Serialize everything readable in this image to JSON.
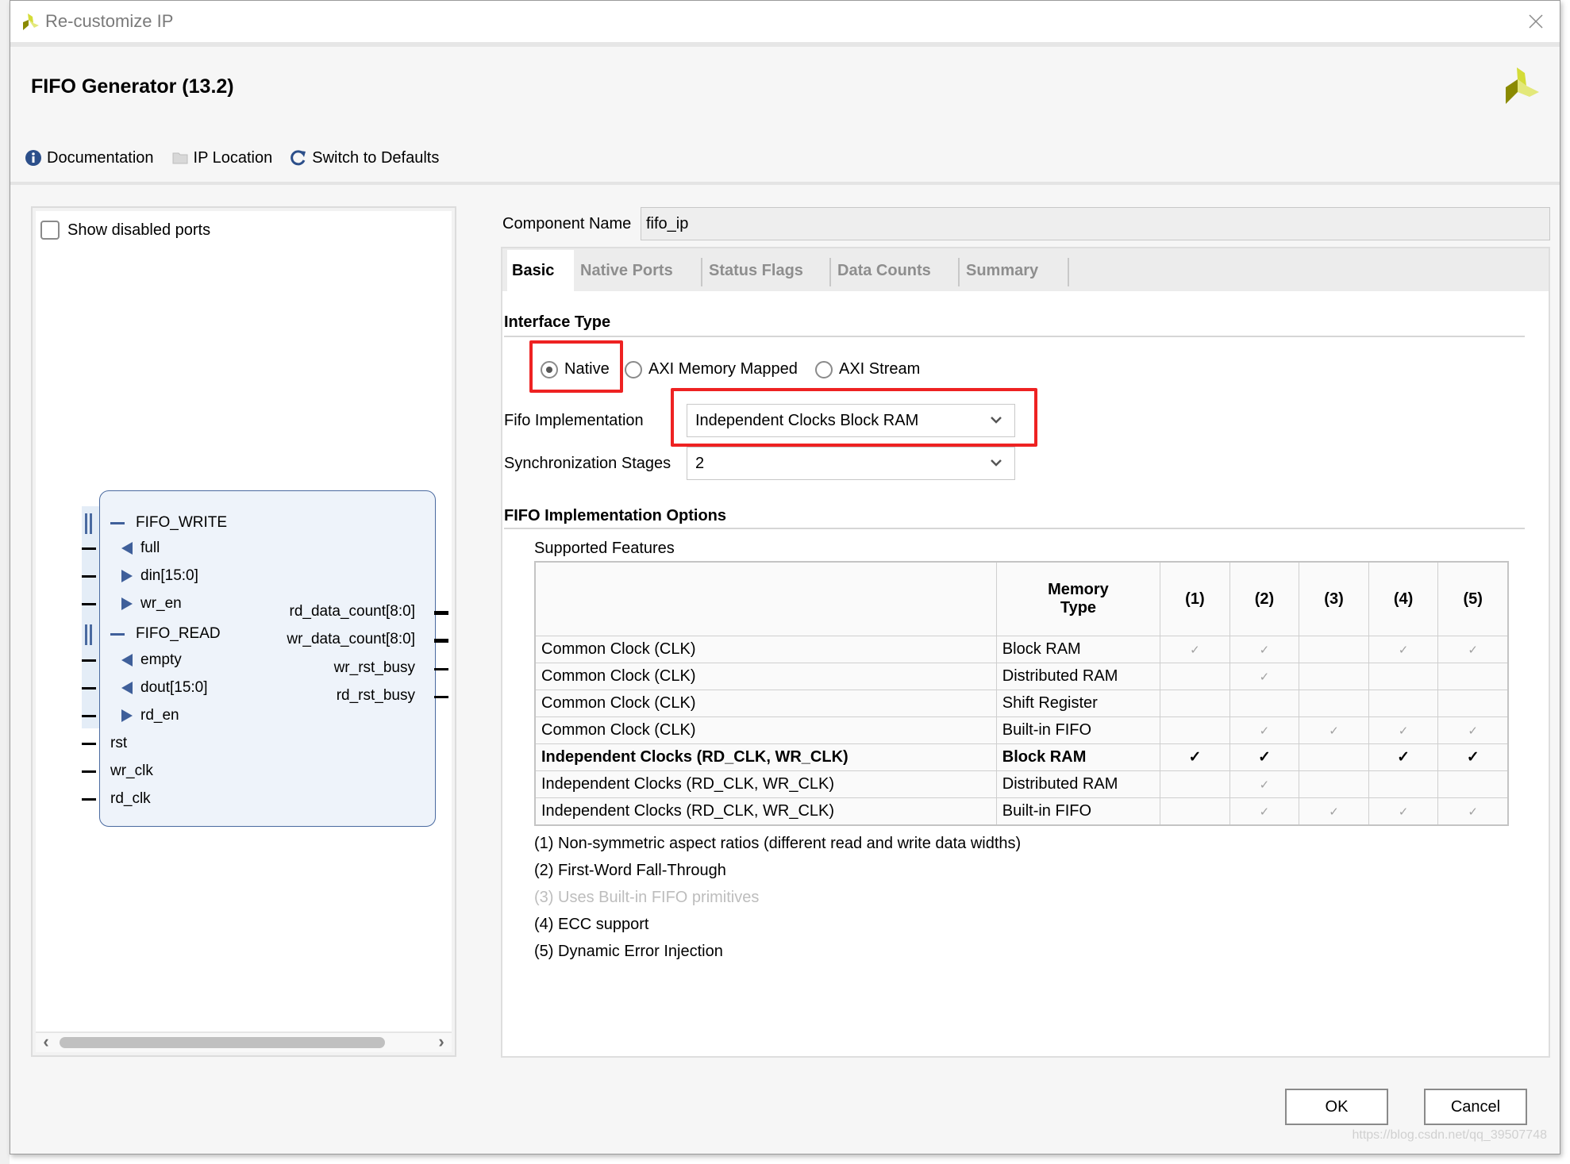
{
  "window": {
    "title": "Re-customize IP",
    "close_icon": "close-icon"
  },
  "header": {
    "title": "FIFO Generator (13.2)",
    "brand_icon": "xilinx-logo-icon"
  },
  "toolbar": {
    "documentation": "Documentation",
    "ip_location": "IP Location",
    "switch_defaults": "Switch to Defaults"
  },
  "left_panel": {
    "show_disabled_ports_label": "Show disabled ports",
    "show_disabled_ports_checked": false,
    "block": {
      "groups": [
        {
          "name": "FIFO_WRITE",
          "ports": [
            {
              "name": "full",
              "dir": "out"
            },
            {
              "name": "din[15:0]",
              "dir": "in"
            },
            {
              "name": "wr_en",
              "dir": "in"
            }
          ]
        },
        {
          "name": "FIFO_READ",
          "ports": [
            {
              "name": "empty",
              "dir": "out"
            },
            {
              "name": "dout[15:0]",
              "dir": "out"
            },
            {
              "name": "rd_en",
              "dir": "in"
            }
          ]
        }
      ],
      "left_ports": [
        "rst",
        "wr_clk",
        "rd_clk"
      ],
      "right_ports": [
        "rd_data_count[8:0]",
        "wr_data_count[8:0]",
        "wr_rst_busy",
        "rd_rst_busy"
      ]
    }
  },
  "component": {
    "label": "Component Name",
    "value": "fifo_ip"
  },
  "tabs": [
    {
      "label": "Basic",
      "active": true
    },
    {
      "label": "Native Ports",
      "active": false
    },
    {
      "label": "Status Flags",
      "active": false
    },
    {
      "label": "Data Counts",
      "active": false
    },
    {
      "label": "Summary",
      "active": false
    }
  ],
  "basic": {
    "interface_type_title": "Interface Type",
    "interface_options": [
      {
        "label": "Native",
        "selected": true
      },
      {
        "label": "AXI Memory Mapped",
        "selected": false
      },
      {
        "label": "AXI Stream",
        "selected": false
      }
    ],
    "fifo_impl_label": "Fifo Implementation",
    "fifo_impl_value": "Independent Clocks Block RAM",
    "sync_stages_label": "Synchronization Stages",
    "sync_stages_value": "2",
    "impl_options_title": "FIFO Implementation Options",
    "supported_features_label": "Supported Features",
    "table": {
      "headers": [
        "",
        "Memory Type",
        "(1)",
        "(2)",
        "(3)",
        "(4)",
        "(5)"
      ],
      "header_memory_line1": "Memory",
      "header_memory_line2": "Type",
      "rows": [
        {
          "clock": "Common Clock (CLK)",
          "memory": "Block RAM",
          "features": [
            true,
            true,
            false,
            true,
            true
          ],
          "selected": false
        },
        {
          "clock": "Common Clock (CLK)",
          "memory": "Distributed RAM",
          "features": [
            false,
            true,
            false,
            false,
            false
          ],
          "selected": false
        },
        {
          "clock": "Common Clock (CLK)",
          "memory": "Shift Register",
          "features": [
            false,
            false,
            false,
            false,
            false
          ],
          "selected": false
        },
        {
          "clock": "Common Clock (CLK)",
          "memory": "Built-in FIFO",
          "features": [
            false,
            true,
            true,
            true,
            true
          ],
          "selected": false
        },
        {
          "clock": "Independent Clocks (RD_CLK, WR_CLK)",
          "memory": "Block RAM",
          "features": [
            true,
            true,
            false,
            true,
            true
          ],
          "selected": true
        },
        {
          "clock": "Independent Clocks (RD_CLK, WR_CLK)",
          "memory": "Distributed RAM",
          "features": [
            false,
            true,
            false,
            false,
            false
          ],
          "selected": false
        },
        {
          "clock": "Independent Clocks (RD_CLK, WR_CLK)",
          "memory": "Built-in FIFO",
          "features": [
            false,
            true,
            true,
            true,
            true
          ],
          "selected": false
        }
      ],
      "check_glyph": "✓"
    },
    "footnotes": [
      {
        "text": "(1) Non-symmetric aspect ratios (different read and write data widths)",
        "dim": false
      },
      {
        "text": "(2) First-Word Fall-Through",
        "dim": false
      },
      {
        "text": "(3) Uses Built-in FIFO primitives",
        "dim": true
      },
      {
        "text": "(4) ECC support",
        "dim": false
      },
      {
        "text": "(5) Dynamic Error Injection",
        "dim": false
      }
    ]
  },
  "buttons": {
    "ok": "OK",
    "cancel": "Cancel"
  },
  "watermark": "https://blog.csdn.net/qq_39507748",
  "colors": {
    "highlight": "#ee2222",
    "port_blue": "#3f5f9a",
    "block_fill": "#eef3fa"
  }
}
